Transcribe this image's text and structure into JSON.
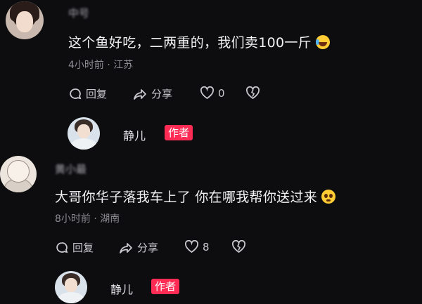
{
  "comments": [
    {
      "username": "中号",
      "text": "这个鱼好吃，二两重的，我们卖100一斤",
      "emoji": "laughing-crying-emoji",
      "time": "4小时前",
      "location": "江苏",
      "reply_label": "回复",
      "share_label": "分享",
      "like_count": "0",
      "author_reply": {
        "name": "静儿",
        "badge": "作者"
      }
    },
    {
      "username": "黄小最",
      "text": "大哥你华子落我车上了 你在哪我帮你送过来",
      "emoji": "pleading-face-emoji",
      "time": "8小时前",
      "location": "湖南",
      "reply_label": "回复",
      "share_label": "分享",
      "like_count": "8",
      "author_reply": {
        "name": "静儿",
        "badge": "作者"
      }
    }
  ],
  "separator": "·",
  "colors": {
    "badge": "#fe2c55",
    "background": "#0d0d10"
  }
}
